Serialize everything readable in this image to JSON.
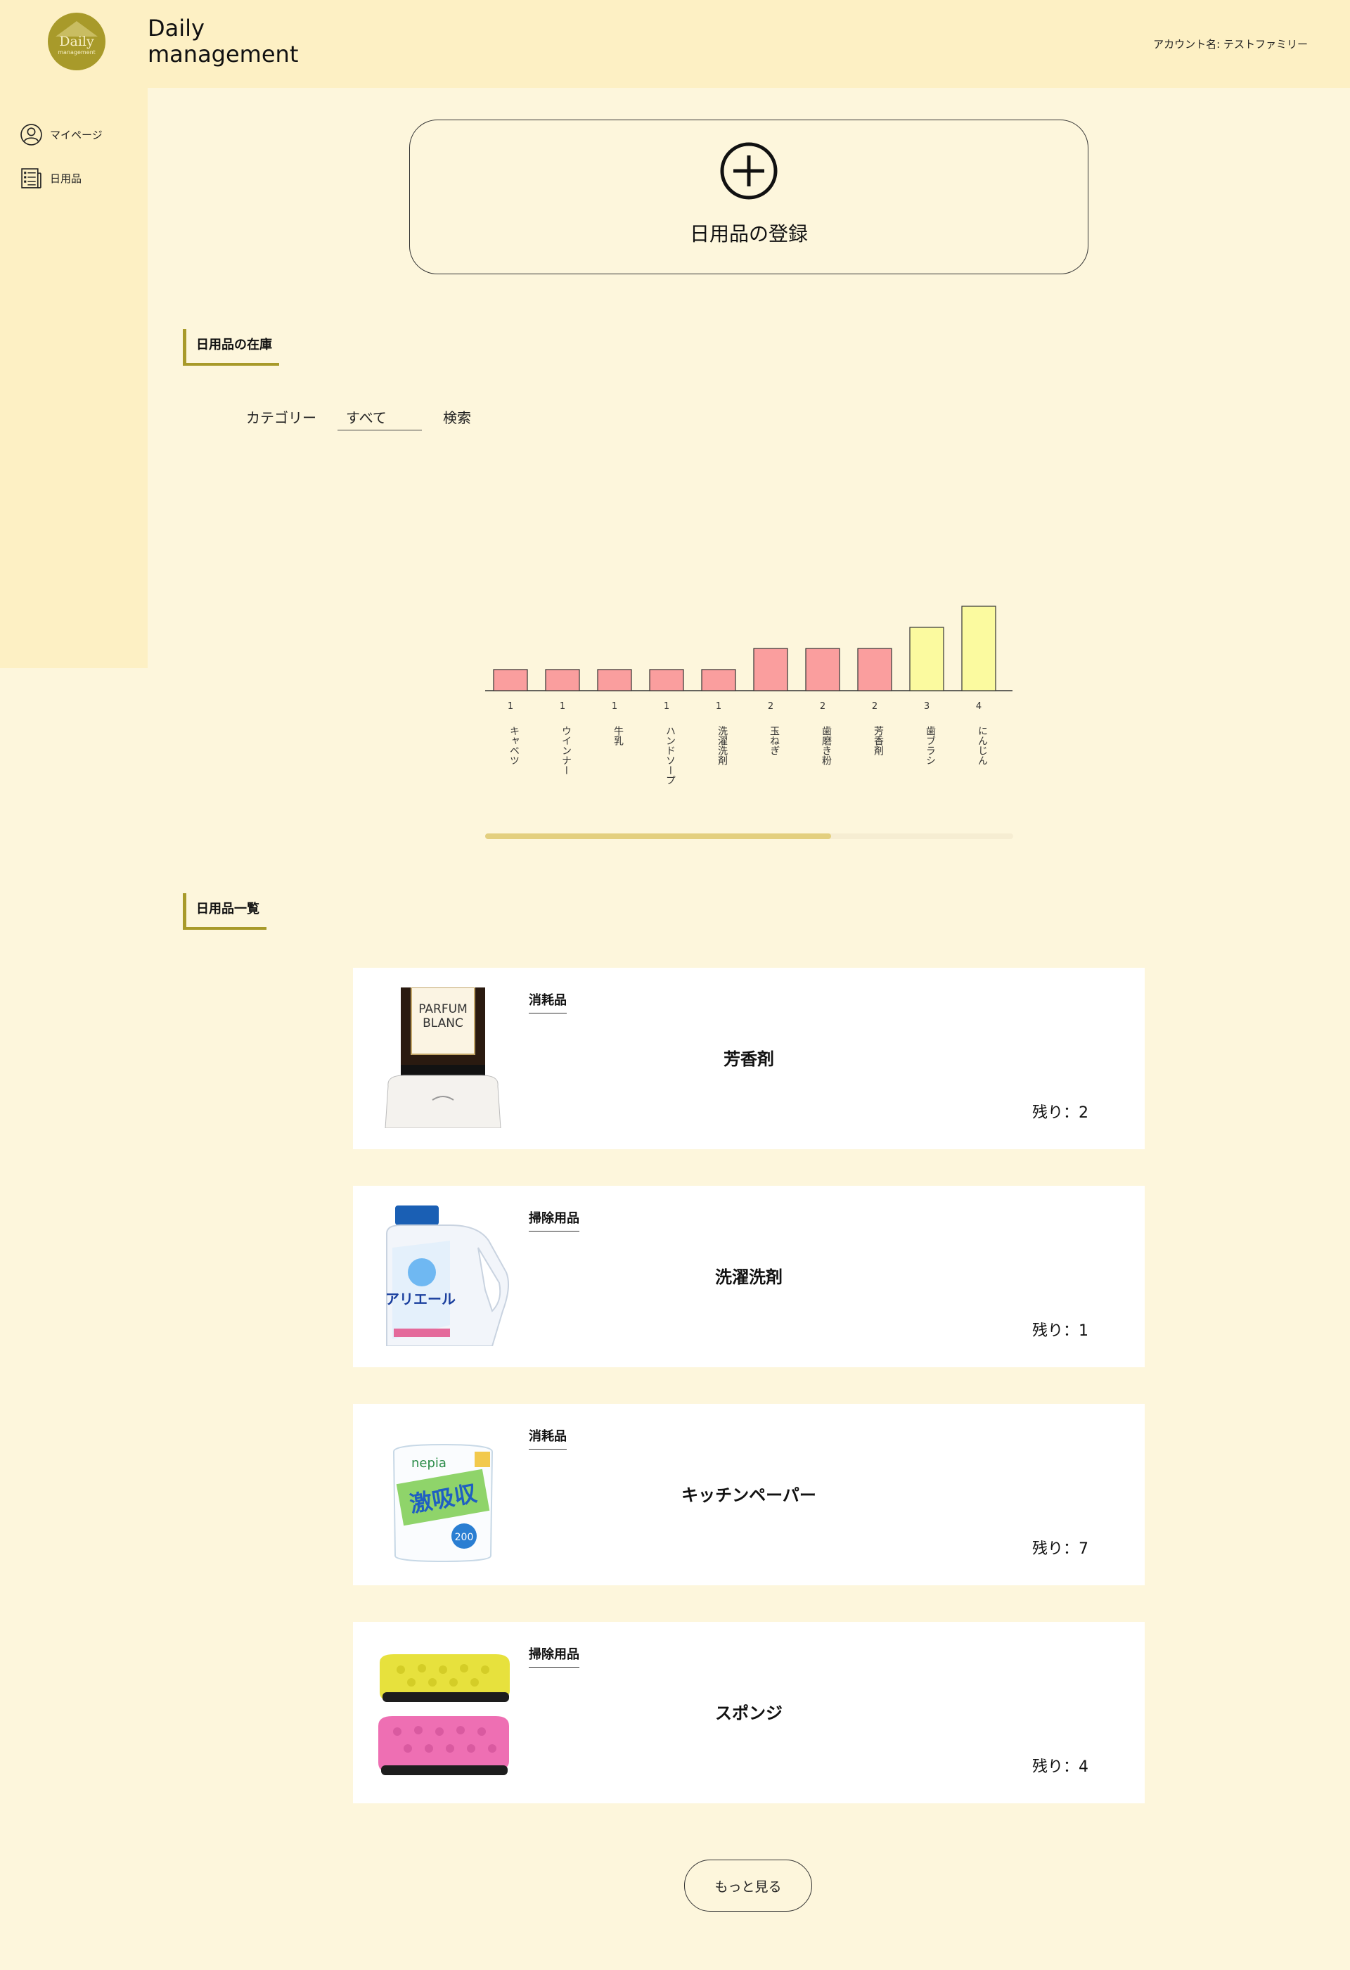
{
  "header": {
    "logo_main": "Daily",
    "logo_sub": "management",
    "title_line1": "Daily",
    "title_line2": "management",
    "account": "アカウント名: テストファミリー"
  },
  "sidebar": {
    "items": [
      {
        "label": "マイページ",
        "icon": "user-icon"
      },
      {
        "label": "日用品",
        "icon": "list-icon"
      }
    ]
  },
  "register": {
    "label": "日用品の登録"
  },
  "stock_section": {
    "title": "日用品の在庫",
    "filter_label": "カテゴリー",
    "filter_value": "すべて",
    "search_label": "検索"
  },
  "chart_data": {
    "type": "bar",
    "categories": [
      "キャベツ",
      "ウインナー",
      "牛乳",
      "ハンドソープ",
      "洗濯洗剤",
      "玉ねぎ",
      "歯磨き粉",
      "芳香剤",
      "歯ブラシ",
      "にんじん"
    ],
    "values": [
      1,
      1,
      1,
      1,
      1,
      2,
      2,
      2,
      3,
      4
    ],
    "colors": [
      "#fa9e9e",
      "#fa9e9e",
      "#fa9e9e",
      "#fa9e9e",
      "#fa9e9e",
      "#fa9e9e",
      "#fa9e9e",
      "#fa9e9e",
      "#fbfa9f",
      "#fbfa9f"
    ],
    "title": "",
    "xlabel": "",
    "ylabel": "",
    "ylim": [
      0,
      4
    ],
    "grid": false,
    "legend": "none"
  },
  "list_section": {
    "title": "日用品一覧",
    "items": [
      {
        "category": "消耗品",
        "name": "芳香剤",
        "remaining": "残り：2",
        "image": "perfume-bottle"
      },
      {
        "category": "掃除用品",
        "name": "洗濯洗剤",
        "remaining": "残り：1",
        "image": "detergent-bottle"
      },
      {
        "category": "消耗品",
        "name": "キッチンペーパー",
        "remaining": "残り：7",
        "image": "paper-towel"
      },
      {
        "category": "掃除用品",
        "name": "スポンジ",
        "remaining": "残り：4",
        "image": "sponges"
      }
    ],
    "image_text": {
      "perfume": "PARFUM\nBLANC",
      "detergent": "アリエール",
      "paper_brand": "nepia",
      "paper_main": "激吸収"
    },
    "more_label": "もっと見る"
  }
}
